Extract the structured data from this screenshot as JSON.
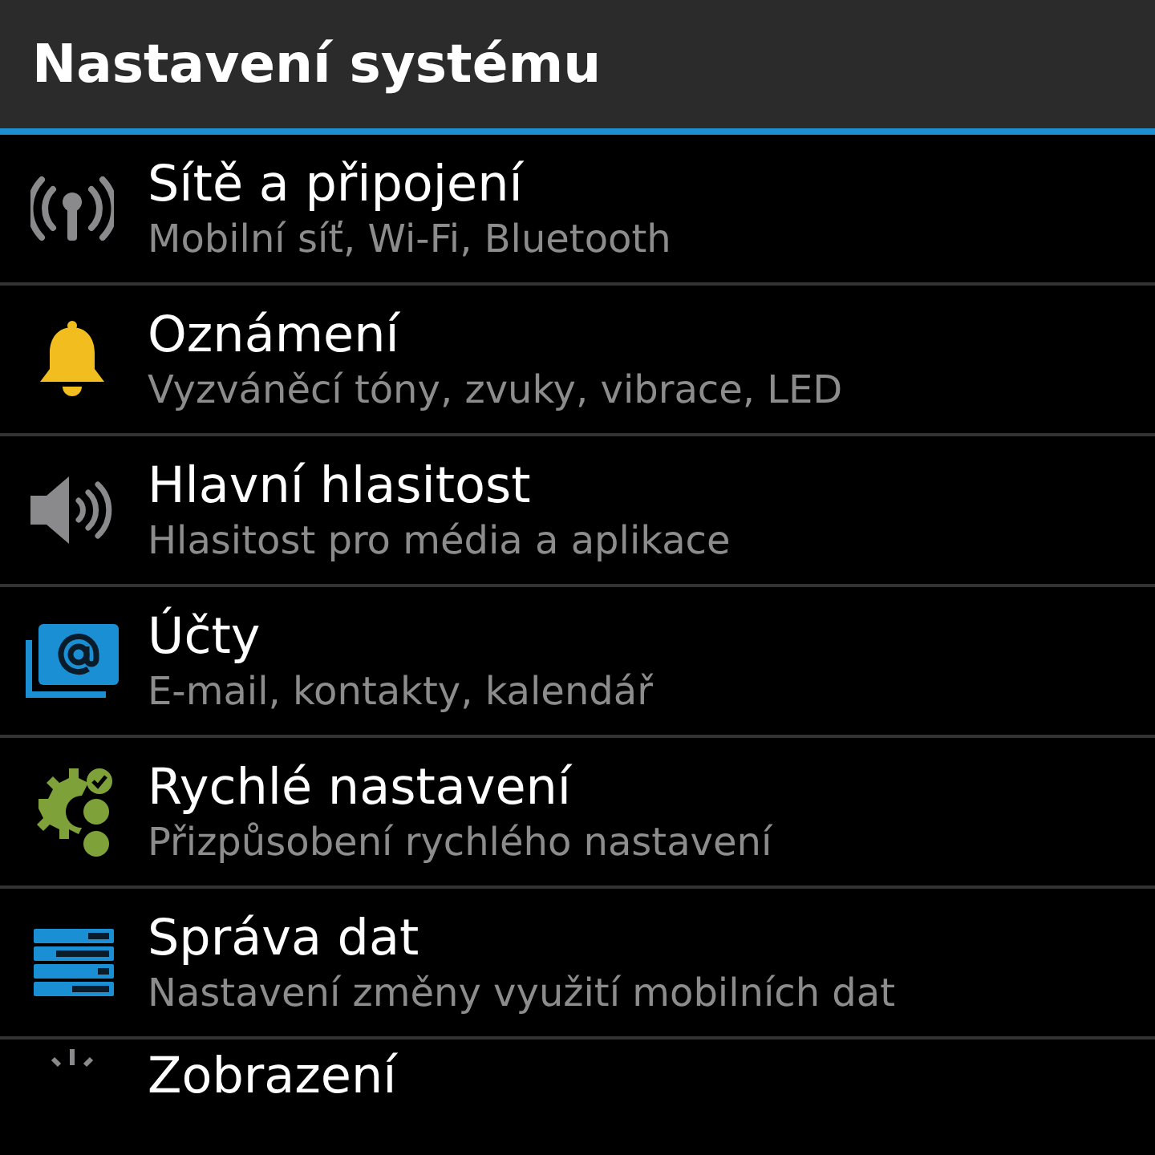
{
  "header": {
    "title": "Nastavení systému"
  },
  "items": [
    {
      "kind": "network",
      "title": "Sítě a připojení",
      "subtitle": "Mobilní síť, Wi-Fi, Bluetooth"
    },
    {
      "kind": "bell",
      "title": "Oznámení",
      "subtitle": "Vyzváněcí tóny, zvuky, vibrace, LED"
    },
    {
      "kind": "speaker",
      "title": "Hlavní hlasitost",
      "subtitle": "Hlasitost pro média a aplikace"
    },
    {
      "kind": "accounts",
      "title": "Účty",
      "subtitle": "E-mail, kontakty, kalendář"
    },
    {
      "kind": "quick",
      "title": "Rychlé nastavení",
      "subtitle": "Přizpůsobení rychlého nastavení"
    },
    {
      "kind": "data",
      "title": "Správa dat",
      "subtitle": "Nastavení změny využití mobilních dat"
    },
    {
      "kind": "display",
      "title": "Zobrazení"
    }
  ]
}
